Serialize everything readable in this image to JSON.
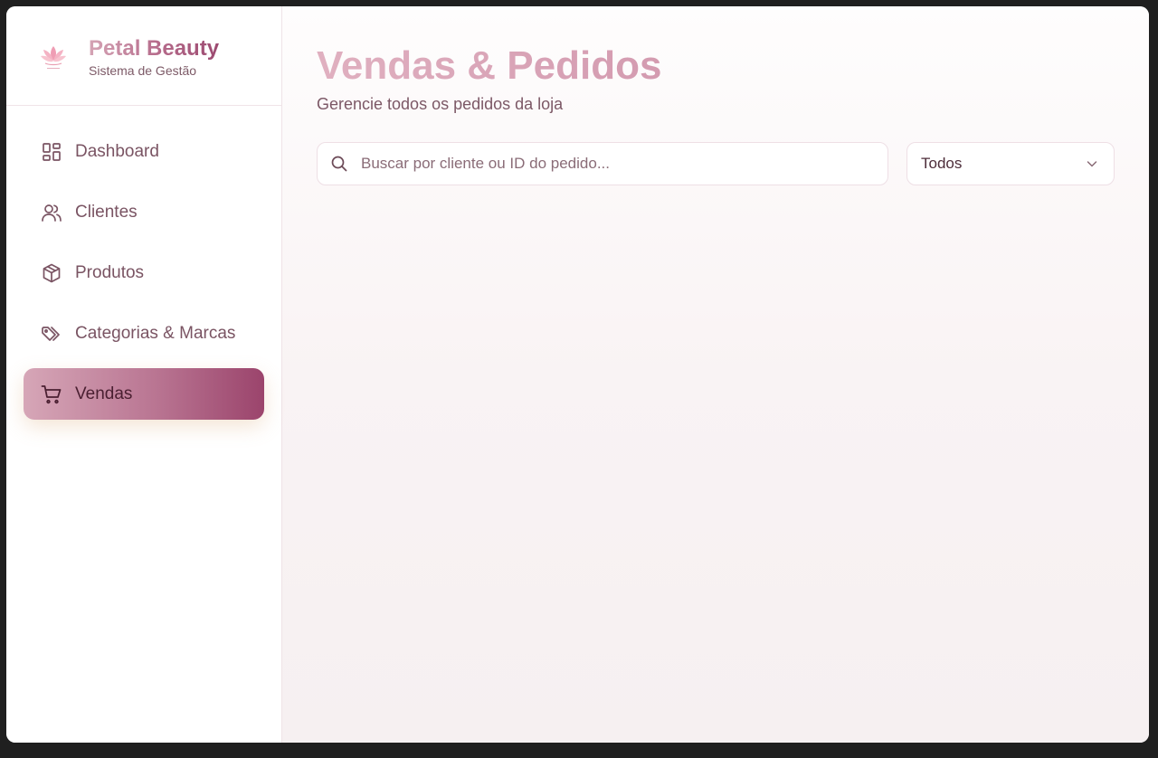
{
  "brand": {
    "name": "Petal Beauty",
    "tagline": "Sistema de Gestão"
  },
  "sidebar": {
    "items": [
      {
        "label": "Dashboard",
        "icon": "dashboard-grid-icon",
        "active": false
      },
      {
        "label": "Clientes",
        "icon": "users-icon",
        "active": false
      },
      {
        "label": "Produtos",
        "icon": "package-box-icon",
        "active": false
      },
      {
        "label": "Categorias & Marcas",
        "icon": "tags-icon",
        "active": false
      },
      {
        "label": "Vendas",
        "icon": "shopping-cart-icon",
        "active": true
      }
    ]
  },
  "main": {
    "title": "Vendas & Pedidos",
    "subtitle": "Gerencie todos os pedidos da loja",
    "search": {
      "placeholder": "Buscar por cliente ou ID do pedido...",
      "value": "",
      "icon": "search-icon"
    },
    "filter": {
      "selected": "Todos",
      "icon": "chevron-down-icon"
    }
  },
  "colors": {
    "accent_start": "#d6a6b7",
    "accent_end": "#9b446c",
    "text_muted": "#7a5463",
    "background": "#f9f3f4"
  }
}
